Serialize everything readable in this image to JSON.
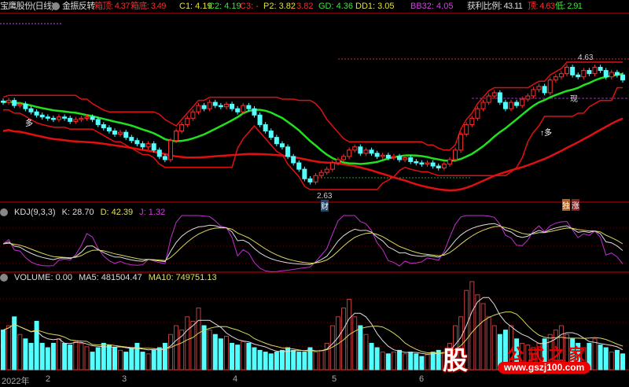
{
  "header": {
    "title": "宝鹰股份(日线)",
    "indicator": "金振反转",
    "top_label": "箱顶: 4.37",
    "bottom_label": "箱底: 3.49",
    "c1": "C1: 4.19",
    "c2": "C2: 4.19",
    "c3": "C3: -",
    "p2": "P2: 3.82",
    "p2b": ": 3.82",
    "gd": "GD: 4.36",
    "dd1": "DD1: 3.05",
    "bb32": "BB32: 4.05",
    "profit": "获利比例: 43.11",
    "high": "顶: 4.63",
    "low": "低: 2.91"
  },
  "kdj": {
    "name": "KDJ(9,3,3)",
    "k": "K: 28.70",
    "d": "D: 42.39",
    "j": "J: 1.32"
  },
  "volume": {
    "name": "VOLUME: 0.00",
    "ma5": "MA5: 481504.47",
    "ma10": "MA10: 749751.13"
  },
  "annotations": {
    "high_mark": "4.63",
    "low_mark": "2.63",
    "cai": "财",
    "duo1": "多",
    "duo2": "↑多",
    "xian": "现",
    "du": "独",
    "zhang": "涨"
  },
  "axis": [
    "2022年",
    "2",
    "3",
    "4",
    "5",
    "6"
  ],
  "watermark": {
    "logo": "股",
    "site": "公式之家",
    "url": "www.gszj100.com"
  },
  "colors": {
    "up": "#ff3030",
    "down": "#54ffff",
    "ma_green": "#20e020",
    "band": "#e01010"
  },
  "chart_data": {
    "type": "candlestick",
    "price_high": 4.63,
    "price_low": 2.63,
    "closes": [
      3.95,
      3.98,
      3.9,
      3.92,
      3.85,
      3.8,
      3.75,
      3.72,
      3.7,
      3.68,
      3.72,
      3.7,
      3.65,
      3.68,
      3.7,
      3.72,
      3.68,
      3.6,
      3.55,
      3.5,
      3.45,
      3.48,
      3.4,
      3.35,
      3.3,
      3.25,
      3.3,
      3.2,
      3.1,
      3.05,
      3.35,
      3.5,
      3.6,
      3.7,
      3.8,
      3.9,
      3.85,
      3.95,
      3.9,
      3.88,
      3.92,
      3.85,
      3.8,
      3.9,
      3.85,
      3.75,
      3.6,
      3.5,
      3.4,
      3.3,
      3.25,
      3.1,
      3.0,
      2.9,
      2.75,
      2.7,
      2.8,
      2.85,
      2.9,
      3.0,
      3.05,
      3.1,
      3.2,
      3.25,
      3.15,
      3.2,
      3.15,
      3.1,
      3.12,
      3.08,
      3.1,
      3.05,
      3.08,
      3.02,
      3.0,
      2.98,
      3.0,
      2.95,
      2.92,
      2.98,
      3.05,
      3.2,
      3.45,
      3.6,
      3.7,
      3.85,
      3.95,
      4.05,
      4.1,
      3.95,
      3.85,
      3.95,
      3.9,
      4.0,
      4.05,
      4.15,
      4.2,
      4.1,
      4.3,
      4.35,
      4.4,
      4.5,
      4.38,
      4.35,
      4.45,
      4.4,
      4.5,
      4.45,
      4.35,
      4.42,
      4.38,
      4.3
    ],
    "volumes": [
      0.45,
      0.5,
      0.6,
      0.4,
      0.35,
      0.3,
      0.55,
      0.3,
      0.25,
      0.3,
      0.35,
      0.3,
      0.28,
      0.32,
      0.3,
      0.26,
      0.2,
      0.25,
      0.3,
      0.28,
      0.25,
      0.22,
      0.2,
      0.25,
      0.3,
      0.2,
      0.18,
      0.22,
      0.25,
      0.3,
      0.4,
      0.5,
      0.45,
      0.6,
      0.55,
      0.7,
      0.5,
      0.45,
      0.4,
      0.35,
      0.38,
      0.3,
      0.28,
      0.32,
      0.3,
      0.25,
      0.22,
      0.2,
      0.18,
      0.2,
      0.22,
      0.25,
      0.22,
      0.2,
      0.2,
      0.25,
      0.2,
      0.22,
      0.3,
      0.5,
      0.6,
      0.7,
      0.8,
      0.6,
      0.5,
      0.4,
      0.3,
      0.25,
      0.2,
      0.18,
      0.2,
      0.22,
      0.18,
      0.2,
      0.18,
      0.15,
      0.17,
      0.2,
      0.22,
      0.2,
      0.3,
      0.5,
      0.6,
      0.9,
      1.0,
      0.85,
      0.75,
      0.6,
      0.5,
      0.4,
      0.45,
      0.5,
      0.35,
      0.3,
      0.28,
      0.25,
      0.3,
      0.35,
      0.4,
      0.45,
      0.5,
      0.4,
      0.35,
      0.3,
      0.25,
      0.3,
      0.35,
      0.28,
      0.25,
      0.2,
      0.22,
      0.18
    ]
  }
}
